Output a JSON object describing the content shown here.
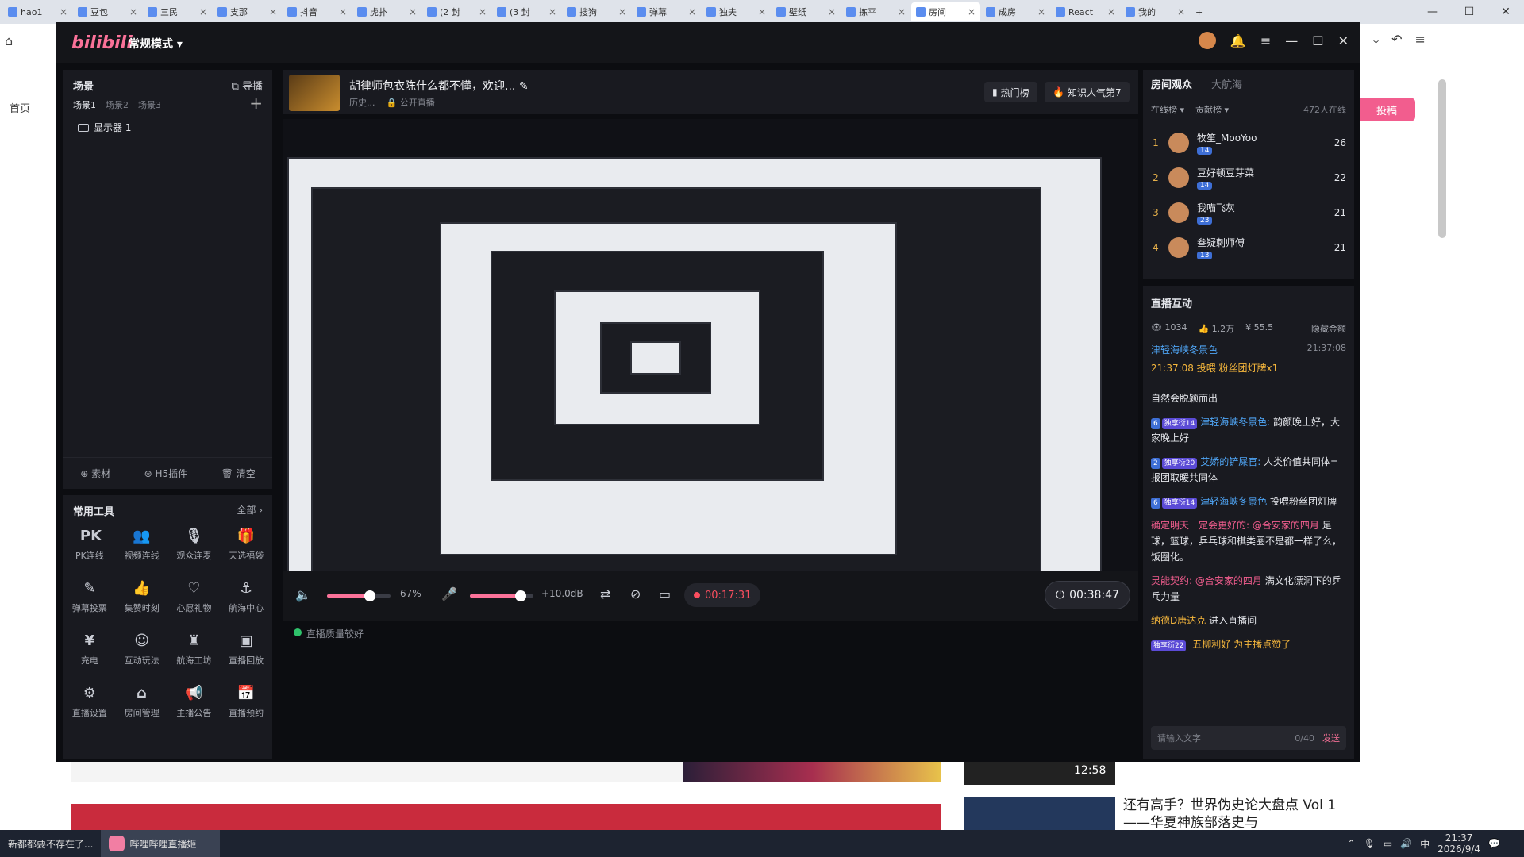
{
  "browser": {
    "tabs": [
      "hao1",
      "豆包",
      "三民",
      "支那",
      "抖音",
      "虎扑",
      "(2 封",
      "(3 封",
      "搜狗",
      "弹幕",
      "独夫",
      "壁纸",
      "拣平",
      "房间",
      "成房",
      "React",
      "我的"
    ],
    "new_tab": "+"
  },
  "background_page": {
    "home_label": "首页",
    "upload_label": "投稿",
    "video_duration": "12:58",
    "video_caption": "还有高手？世界伪史论大盘点 Vol 1——华夏神族部落史与"
  },
  "studio": {
    "logo": "bilibili",
    "mode": "常规模式",
    "scene_panel": {
      "title": "场景",
      "guide": "导播",
      "tabs": [
        "场景1",
        "场景2",
        "场景3"
      ],
      "source": "显示器 1",
      "footer": [
        "素材",
        "H5插件",
        "清空"
      ]
    },
    "tools_panel": {
      "title": "常用工具",
      "all": "全部",
      "tools": [
        {
          "icon": "PK",
          "label": "PK连线"
        },
        {
          "icon": "👥",
          "label": "视频连线"
        },
        {
          "icon": "🎙",
          "label": "观众连麦"
        },
        {
          "icon": "🎁",
          "label": "天选福袋"
        },
        {
          "icon": "✎",
          "label": "弹幕投票"
        },
        {
          "icon": "👍",
          "label": "集赞时刻"
        },
        {
          "icon": "♡",
          "label": "心愿礼物"
        },
        {
          "icon": "⚓",
          "label": "航海中心"
        },
        {
          "icon": "¥",
          "label": "充电"
        },
        {
          "icon": "☺",
          "label": "互动玩法"
        },
        {
          "icon": "♜",
          "label": "航海工坊"
        },
        {
          "icon": "▣",
          "label": "直播回放"
        },
        {
          "icon": "⚙",
          "label": "直播设置"
        },
        {
          "icon": "⌂",
          "label": "房间管理"
        },
        {
          "icon": "📢",
          "label": "主播公告"
        },
        {
          "icon": "📅",
          "label": "直播预约"
        }
      ]
    },
    "stream_info": {
      "title": "胡律师包衣陈什么都不懂，欢迎...",
      "history": "历史...",
      "visibility": "公开直播",
      "hot_rank": "热门榜",
      "knowledge_rank": "知识人气第7"
    },
    "controls": {
      "volume_percent": "67%",
      "volume_level": 0.67,
      "mic_gain": "+10.0dB",
      "mic_level": 0.8,
      "rec_time": "00:17:31",
      "live_time": "00:38:47",
      "status": "直播质量较好"
    },
    "audience": {
      "tabs": [
        "房间观众",
        "大航海"
      ],
      "filters": [
        "在线榜",
        "贡献榜"
      ],
      "count": "472人在线",
      "rows": [
        {
          "rank": "1",
          "name": "牧笙_MooYoo",
          "badge": "14",
          "score": "26"
        },
        {
          "rank": "2",
          "name": "豆好顿豆芽菜",
          "badge": "14",
          "score": "22"
        },
        {
          "rank": "3",
          "name": "我喵飞灰",
          "badge": "23",
          "score": "21"
        },
        {
          "rank": "4",
          "name": "叁疑刺师傅",
          "badge": "13",
          "score": "21"
        }
      ]
    },
    "interaction": {
      "title": "直播互动",
      "views": "1034",
      "likes": "1.2万",
      "revenue": "55.5",
      "hide_amount": "隐藏金额",
      "gift_user": "津轻海峡冬景色",
      "gift_time": "21:37:08",
      "gift_line": "21:37:08 投喂 粉丝团灯牌x1",
      "messages": [
        {
          "lvl": "",
          "medal": "",
          "user": "",
          "text": "自然会脱颖而出"
        },
        {
          "lvl": "6",
          "medal": "独享衍14",
          "user": "津轻海峡冬景色:",
          "text": " 韵颜晚上好，大家晚上好"
        },
        {
          "lvl": "2",
          "medal": "独享衍20",
          "user": "艾娇的铲屎官:",
          "text": " 人类价值共同体=报团取暖共同体"
        },
        {
          "lvl": "6",
          "medal": "独享衍14",
          "user": "津轻海峡冬景色",
          "text": " 投喂粉丝团灯牌"
        }
      ],
      "pink_msg_1_prefix": "确定明天一定会更好的: ",
      "pink_msg_1_mention": "@合安家的四月",
      "pink_msg_1_text": " 足球，篮球，乒乓球和棋类圈不是都一样了么，饭圈化。",
      "pink_msg_2_prefix": "灵能契约: ",
      "pink_msg_2_mention": "@合安家的四月",
      "pink_msg_2_text": " 满文化漂洞下的乒乓力量",
      "enter_user": "纳德D唐达克",
      "enter_text": " 进入直播间",
      "follow_medal": "独享衍22",
      "follow_text": " 五柳利好 为主播点赞了",
      "input_placeholder": "请输入文字",
      "input_count": "0/40",
      "send": "发送"
    }
  },
  "taskbar": {
    "item1": "新都都要不存在了...",
    "item2": "哔哩哔哩直播姬",
    "ime": "中",
    "time": "21:37",
    "date": "2026/9/4"
  }
}
